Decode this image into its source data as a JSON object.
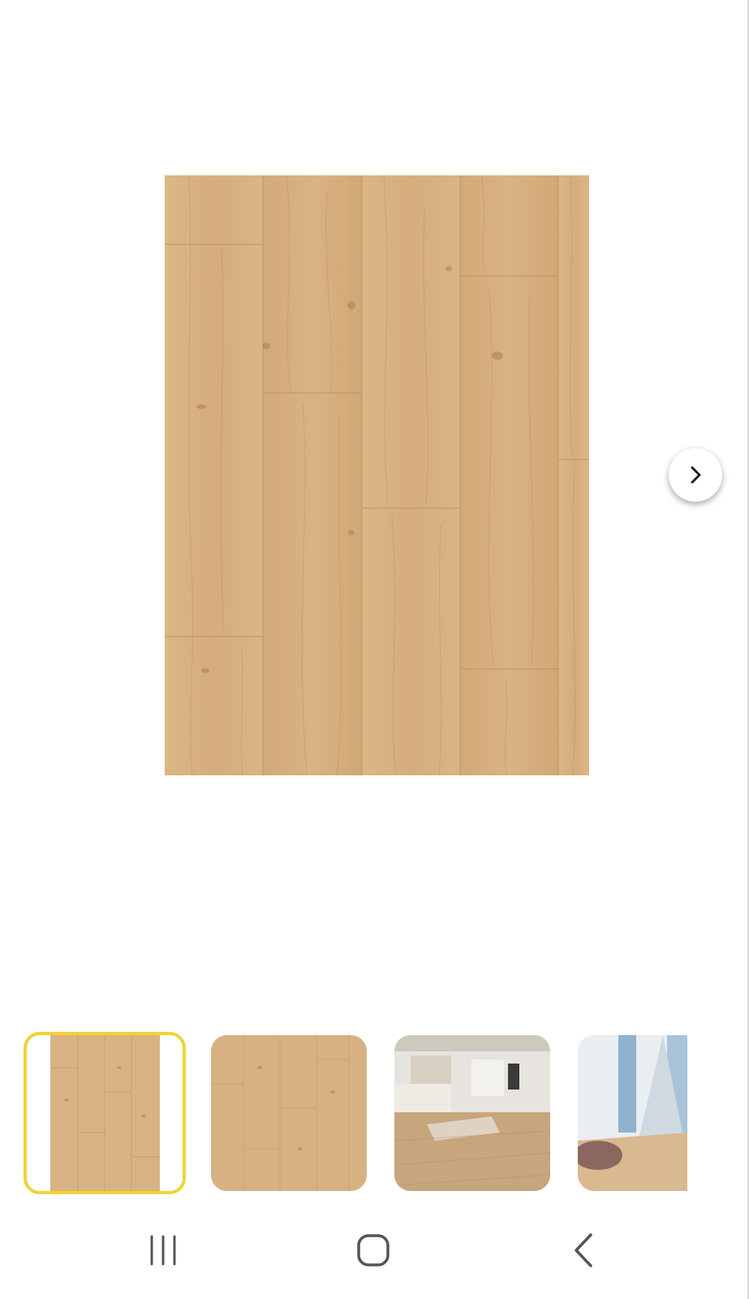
{
  "gallery": {
    "main_image": "wood-plank-flooring-image",
    "next_icon": "chevron-right-icon",
    "thumbnails": [
      {
        "name": "thumbnail-wood-texture-1",
        "selected": true
      },
      {
        "name": "thumbnail-wood-texture-2",
        "selected": false
      },
      {
        "name": "thumbnail-living-room",
        "selected": false
      },
      {
        "name": "thumbnail-room-partial",
        "selected": false
      }
    ],
    "selected_border_color": "#f2d234"
  },
  "navigation": {
    "recents_icon": "recents-icon",
    "home_icon": "home-icon",
    "back_icon": "back-icon"
  }
}
